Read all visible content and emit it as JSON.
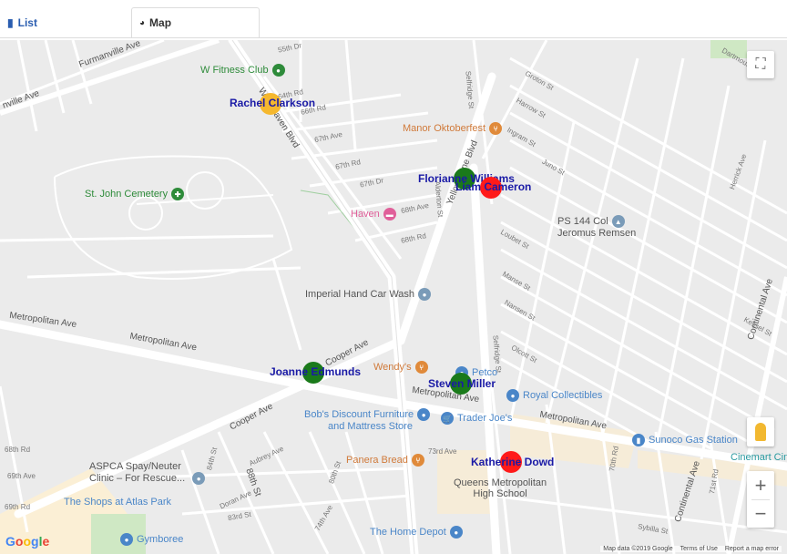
{
  "tabs": {
    "list_label": "List",
    "map_label": "Map"
  },
  "markers": [
    {
      "name": "Rachel Clarkson",
      "color": "#f5b82e"
    },
    {
      "name": "Florianne Williams",
      "color": "#1a7a1a"
    },
    {
      "name": "Liam Cameron",
      "color": "#ff1a1a"
    },
    {
      "name": "Joanne Edmunds",
      "color": "#1a7a1a"
    },
    {
      "name": "Steven Miller",
      "color": "#1a7a1a"
    },
    {
      "name": "Katherine Dowd",
      "color": "#ff1a1a"
    }
  ],
  "pois": {
    "w_fitness": "W Fitness Club",
    "manor": "Manor Oktoberfest",
    "st_john": "St. John Cemetery",
    "haven": "Haven",
    "ps144_1": "PS 144 Col",
    "ps144_2": "Jeromus Remsen",
    "imperial": "Imperial Hand Car Wash",
    "wendys": "Wendy's",
    "petco": "Petco",
    "royal": "Royal Collectibles",
    "bobs_1": "Bob's Discount Furniture",
    "bobs_2": "and Mattress Store",
    "trader": "Trader Joe's",
    "sunoco": "Sunoco Gas Station",
    "cinemart": "Cinemart Cin",
    "aspca_1": "ASPCA Spay/Neuter",
    "aspca_2": "Clinic – For Rescue...",
    "panera": "Panera Bread",
    "queens_1": "Queens Metropolitan",
    "queens_2": "High School",
    "shops": "The Shops at Atlas Park",
    "gymboree": "Gymboree",
    "homedepot": "The Home Depot"
  },
  "streets": {
    "furmanville_1": "Furmanville Ave",
    "furmanville_2": "nville Ave",
    "woodhaven": "Woodhaven Blvd",
    "yellowstone": "Yellowstone Blvd",
    "metropolitan_1": "Metropolitan Ave",
    "metropolitan_2": "Metropolitan Ave",
    "metropolitan_3": "Metropolitan Ave",
    "metropolitan_4": "Metropolitan Ave",
    "cooper_1": "Cooper Ave",
    "cooper_2": "Cooper Ave",
    "continental_1": "Continental Ave",
    "continental_2": "Continental Ave",
    "s_55th": "55th Dr",
    "s_64th": "64th Rd",
    "s_66th": "66th Rd",
    "s_67th": "67th Ave",
    "s_67rd": "67th Rd",
    "s_67dr": "67th Dr",
    "s_68ave": "68th Ave",
    "s_68rd": "68th Rd",
    "s_68rd2": "68th Rd",
    "s_69ave": "69th Ave",
    "s_69rd": "69th Rd",
    "s_73rd": "73rd Ave",
    "s_74th": "74th Ave",
    "s_83rd": "83rd St",
    "s_84th": "84th St",
    "s_88th": "88th St",
    "s_80th": "80th St",
    "s_groton": "Groton St",
    "s_harrow": "Harrow St",
    "s_ingram": "Ingram St",
    "s_juno": "Juno St",
    "s_kessel": "Kessel St",
    "s_loubet": "Loubet St",
    "s_manse": "Manse St",
    "s_nansen": "Nansen St",
    "s_olcott": "Olcott St",
    "s_selfridge": "Selfridge St",
    "s_selfridge2": "Selfridge St",
    "s_alderton": "Alderton St",
    "s_aubrey": "Aubrey Ave",
    "s_doran": "Doran Ave",
    "s_sybilla": "Sybilla St",
    "s_dartmouth": "Dartmouth St",
    "s_herrick": "Herrick Ave",
    "s_70rd": "70th Rd",
    "s_71st": "71st Rd"
  },
  "logo": "Google",
  "footer": {
    "mapdata": "Map data ©2019 Google",
    "terms": "Terms of Use",
    "report": "Report a map error"
  },
  "controls": {
    "zoom_in": "+",
    "zoom_out": "−"
  },
  "colors": {
    "map_bg": "#ebebeb",
    "road": "#ffffff",
    "poi_green": "#2e8b3a",
    "poi_orange": "#e08a3a",
    "poi_blue": "#4a86c8",
    "poi_pink": "#e0609a"
  }
}
